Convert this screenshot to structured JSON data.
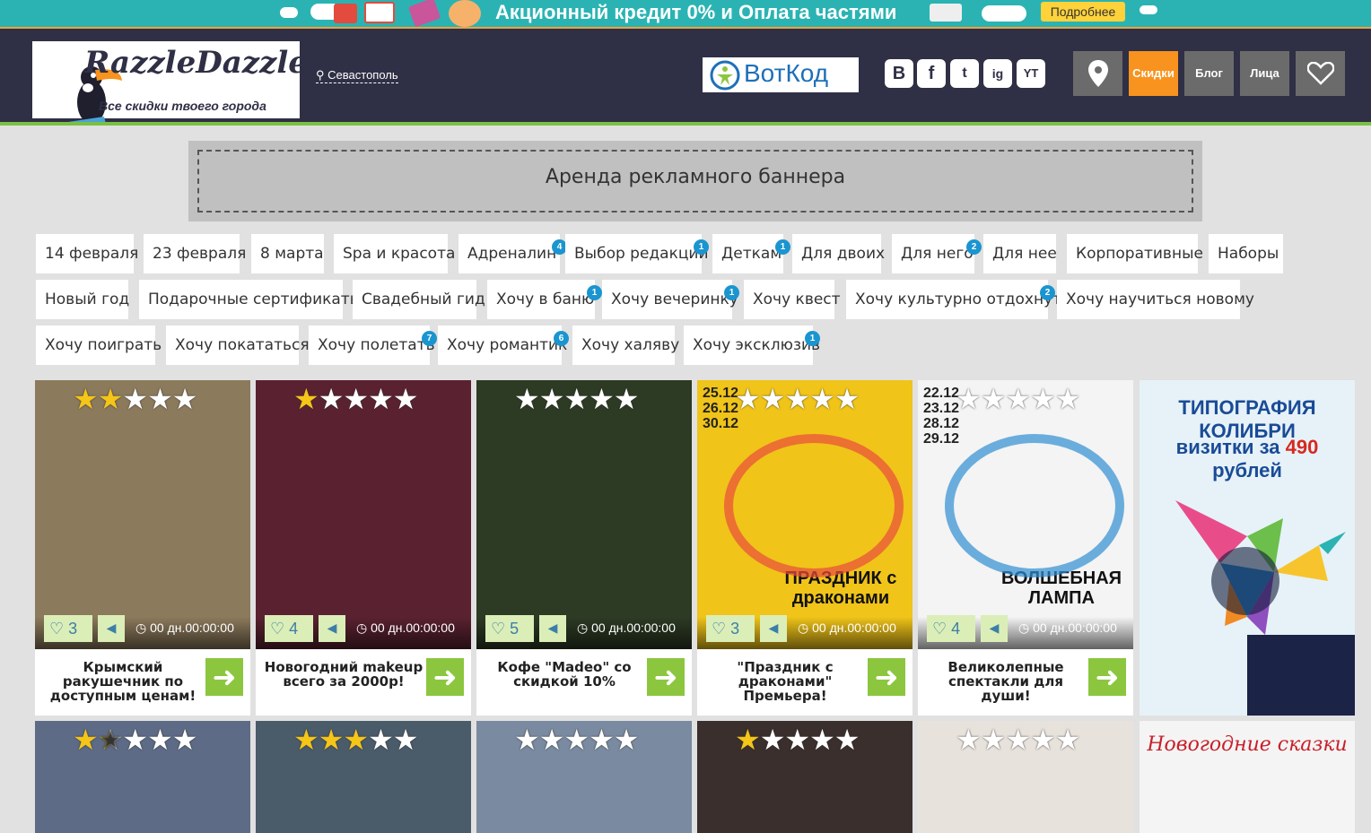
{
  "promo": {
    "text": "Акционный кредит 0% и Оплата частями",
    "button": "Подробнее"
  },
  "header": {
    "logo_title": "RazzleDazzle",
    "logo_subtitle": "Все скидки твоего города",
    "city": "Севастополь",
    "partner": "ВотКод",
    "social": [
      "B",
      "f",
      "t",
      "ig",
      "YT"
    ],
    "nav": [
      "Скидки",
      "Блог",
      "Лица"
    ]
  },
  "banner": {
    "label": "Аренда рекламного баннера"
  },
  "tags": [
    {
      "label": "14 февраля"
    },
    {
      "label": "23 февраля"
    },
    {
      "label": "8 марта"
    },
    {
      "label": "Spa и красота"
    },
    {
      "label": "Адреналин",
      "badge": "4"
    },
    {
      "label": "Выбор редакции",
      "badge": "1"
    },
    {
      "label": "Деткам",
      "badge": "1"
    },
    {
      "label": "Для двоих"
    },
    {
      "label": "Для него",
      "badge": "2"
    },
    {
      "label": "Для нее"
    },
    {
      "label": "Корпоративные"
    },
    {
      "label": "Наборы"
    },
    {
      "label": "Новый год"
    },
    {
      "label": "Подарочные сертификаты"
    },
    {
      "label": "Свадебный гид"
    },
    {
      "label": "Хочу в баню",
      "badge": "1"
    },
    {
      "label": "Хочу вечеринку",
      "badge": "1"
    },
    {
      "label": "Хочу квест"
    },
    {
      "label": "Хочу культурно отдохнуть",
      "badge": "2"
    },
    {
      "label": "Хочу научиться новому"
    },
    {
      "label": "Хочу поиграть"
    },
    {
      "label": "Хочу покататься"
    },
    {
      "label": "Хочу полетать",
      "badge": "7"
    },
    {
      "label": "Хочу романтик",
      "badge": "6"
    },
    {
      "label": "Хочу халяву"
    },
    {
      "label": "Хочу эксклюзив",
      "badge": "1"
    }
  ],
  "cards": [
    {
      "title": "Крымский ракушечник по доступным ценам!",
      "likes": "3",
      "stars": 2,
      "timer": "00 дн.00:00:00",
      "img_color": "#8c7a5c"
    },
    {
      "title": "Новогодний makeup всего за 2000р!",
      "likes": "4",
      "stars": 1,
      "timer": "00 дн.00:00:00",
      "img_color": "#5a2230"
    },
    {
      "title": "Кофе \"Madeo\" со скидкой 10%",
      "likes": "5",
      "stars": 0,
      "timer": "00 дн.00:00:00",
      "img_color": "#2d3a24"
    },
    {
      "title": "\"Праздник с драконами\" Премьера!",
      "likes": "3",
      "stars": 0,
      "timer": "00 дн.00:00:00",
      "img_color": "#f0c419",
      "poster_dates": "25.12\n26.12\n30.12",
      "poster_title": "ПРАЗДНИК с драконами"
    },
    {
      "title": "Великолепные спектакли для души!",
      "likes": "4",
      "stars": 0,
      "timer": "00 дн.00:00:00",
      "img_color": "#f4f4f4",
      "poster_dates": "22.12\n23.12\n28.12\n29.12",
      "poster_title": "ВОЛШЕБНАЯ ЛАМПА"
    }
  ],
  "side_ad": {
    "line1": "ТИПОГРАФИЯ КОЛИБРИ",
    "line2_a": "визитки за ",
    "line2_b": "490",
    "line2_c": " рублей"
  },
  "row2": [
    {
      "stars": 1.5,
      "img_color": "#5d6b86"
    },
    {
      "stars": 3,
      "img_color": "#4a5b6a"
    },
    {
      "stars": 0,
      "img_color": "#7a8aa0"
    },
    {
      "stars": 1,
      "img_color": "#3a2f2c"
    },
    {
      "stars": 0,
      "img_color": "#e8e2dc"
    },
    {
      "stars": 0,
      "img_color": "#f4f4f4",
      "text": "Новогодние сказки"
    }
  ]
}
